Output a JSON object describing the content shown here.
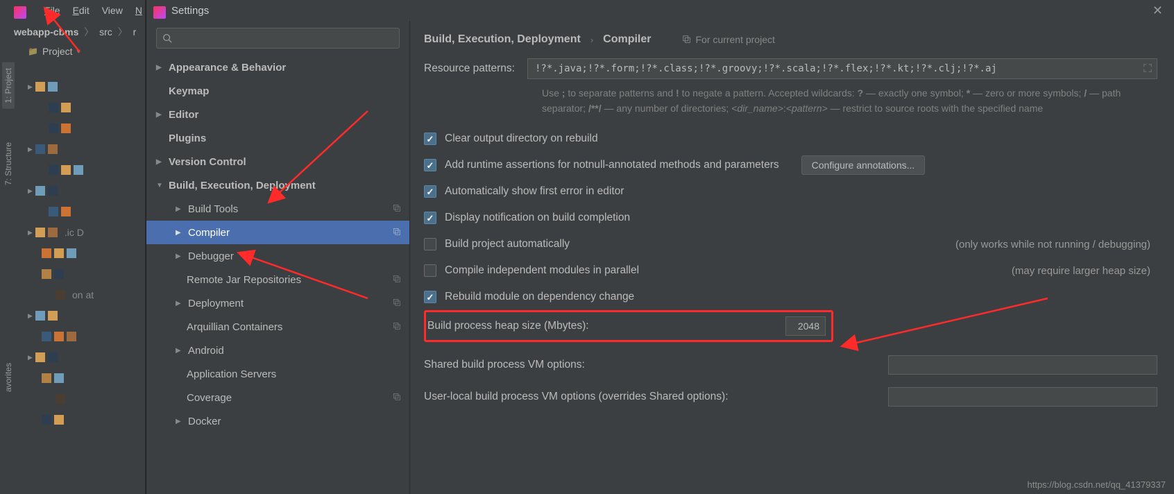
{
  "menubar": {
    "file": "File",
    "edit": "Edit",
    "view": "View",
    "n": "N"
  },
  "breadcrumbs": {
    "root": "webapp-cbms",
    "a": "src",
    "b": "r"
  },
  "project_label": "Project",
  "sidetabs": {
    "project": "1: Project",
    "structure": "7: Structure",
    "fav": "avorites"
  },
  "dialog": {
    "title": "Settings"
  },
  "nav": {
    "appearance": "Appearance & Behavior",
    "keymap": "Keymap",
    "editor": "Editor",
    "plugins": "Plugins",
    "vcs": "Version Control",
    "bed": "Build, Execution, Deployment",
    "build_tools": "Build Tools",
    "compiler": "Compiler",
    "debugger": "Debugger",
    "remote_jar": "Remote Jar Repositories",
    "deployment": "Deployment",
    "arquillian": "Arquillian Containers",
    "android": "Android",
    "app_servers": "Application Servers",
    "coverage": "Coverage",
    "docker": "Docker"
  },
  "content": {
    "bc_root": "Build, Execution, Deployment",
    "bc_leaf": "Compiler",
    "for_project": "For current project",
    "resource_label": "Resource patterns:",
    "resource_value": "!?*.java;!?*.form;!?*.class;!?*.groovy;!?*.scala;!?*.flex;!?*.kt;!?*.clj;!?*.aj",
    "hint": "Use ; to separate patterns and ! to negate a pattern. Accepted wildcards: ? — exactly one symbol; * — zero or more symbols; / — path separator; /**/ — any number of directories; <dir_name>:<pattern> — restrict to source roots with the specified name",
    "chk1": "Clear output directory on rebuild",
    "chk2": "Add runtime assertions for notnull-annotated methods and parameters",
    "conf_ann": "Configure annotations...",
    "chk3": "Automatically show first error in editor",
    "chk4": "Display notification on build completion",
    "chk5": "Build project automatically",
    "chk5_hint": "(only works while not running / debugging)",
    "chk6": "Compile independent modules in parallel",
    "chk6_hint": "(may require larger heap size)",
    "chk7": "Rebuild module on dependency change",
    "heap_label": "Build process heap size (Mbytes):",
    "heap_value": "2048",
    "shared_vm": "Shared build process VM options:",
    "user_vm": "User-local build process VM options (overrides Shared options):"
  },
  "watermark": "https://blog.csdn.net/qq_41379337"
}
